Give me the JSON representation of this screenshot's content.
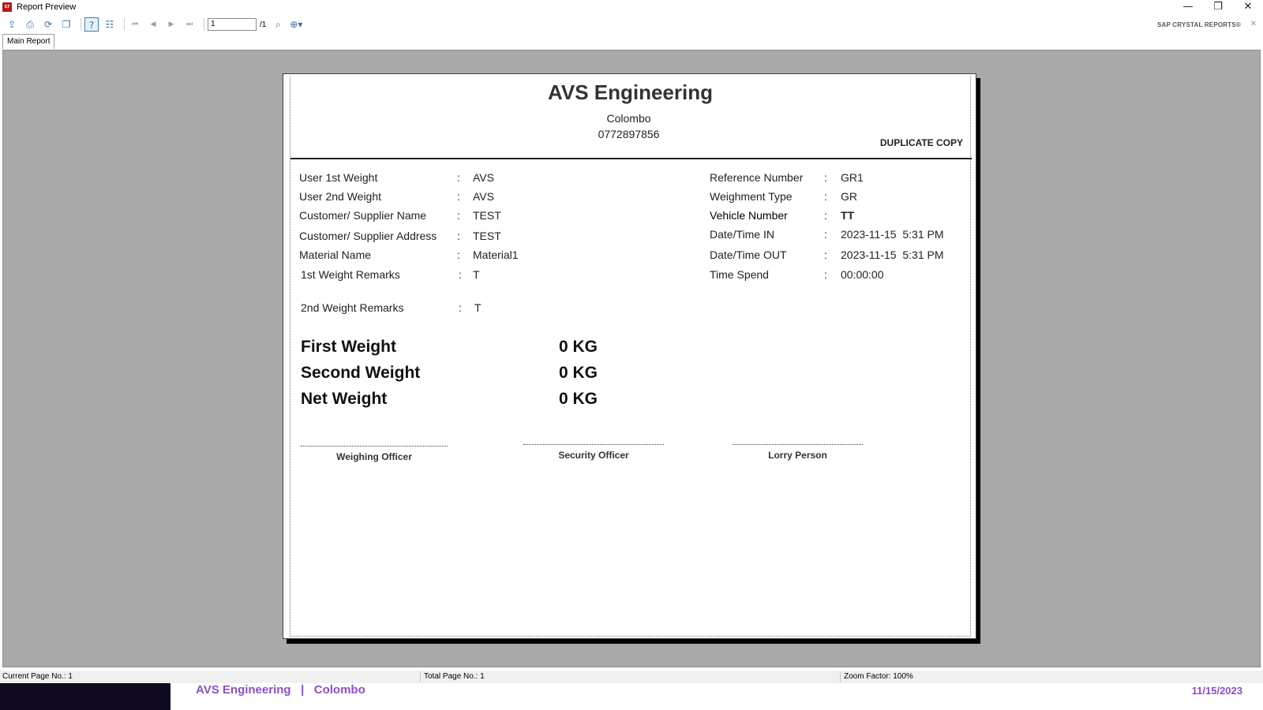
{
  "window": {
    "title": "Report Preview",
    "minimize": "—",
    "restore": "❐",
    "close": "✕"
  },
  "toolbar": {
    "page_value": "1",
    "page_total": "/1",
    "brand": "SAP CRYSTAL REPORTS®"
  },
  "tabs": [
    {
      "label": "Main Report"
    }
  ],
  "report": {
    "company": "AVS Engineering",
    "city": "Colombo",
    "phone": "0772897856",
    "copy_label": "DUPLICATE COPY",
    "left_fields": [
      {
        "label": "User 1st Weight",
        "value": "AVS"
      },
      {
        "label": "User 2nd Weight",
        "value": "AVS"
      },
      {
        "label": "Customer/ Supplier Name",
        "value": "TEST"
      },
      {
        "label": "Customer/ Supplier Address",
        "value": "TEST"
      },
      {
        "label": "Material Name",
        "value": "Material1"
      },
      {
        "label": "1st Weight Remarks",
        "value": "T"
      },
      {
        "label": "2nd Weight Remarks",
        "value": "T"
      }
    ],
    "right_fields": [
      {
        "label": "Reference Number",
        "value": "GR1"
      },
      {
        "label": "Weighment Type",
        "value": "GR"
      },
      {
        "label": "Vehicle Number",
        "value": "TT"
      },
      {
        "label": "Date/Time IN",
        "value": "2023-11-15  5:31 PM"
      },
      {
        "label": "Date/Time OUT",
        "value": "2023-11-15  5:31 PM"
      },
      {
        "label": "Time Spend",
        "value": "00:00:00"
      }
    ],
    "colon": ":",
    "weights": [
      {
        "label": "First Weight",
        "value": "0 KG"
      },
      {
        "label": "Second Weight",
        "value": "0 KG"
      },
      {
        "label": "Net Weight",
        "value": "0 KG"
      }
    ],
    "signatures": [
      "Weighing Officer",
      "Security Officer",
      "Lorry Person"
    ]
  },
  "status": {
    "current_page": "Current Page No.: 1",
    "total_page": "Total Page No.: 1",
    "zoom": "Zoom Factor: 100%"
  },
  "taskbar": {
    "text": "AVS Engineering   |   Colombo",
    "date": "11/15/2023"
  }
}
